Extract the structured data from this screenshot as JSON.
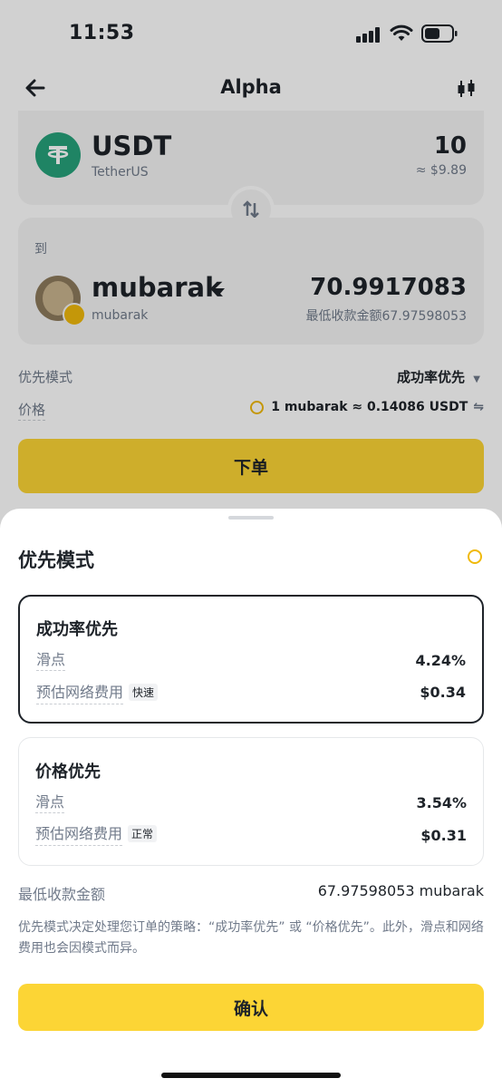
{
  "status_bar": {
    "time": "11:53"
  },
  "header": {
    "title": "Alpha"
  },
  "from": {
    "symbol": "USDT",
    "name": "TetherUS",
    "amount": "10",
    "usd_value": "≈ $9.89"
  },
  "to": {
    "label": "到",
    "symbol": "mubarak",
    "name": "mubarak",
    "amount": "70.9917083",
    "min_receive": "最低收款金额67.97598053"
  },
  "settings": {
    "priority_label": "优先模式",
    "priority_value": "成功率优先",
    "price_label": "价格",
    "price_value": "1 mubarak ≈ 0.14086 USDT"
  },
  "order_button": "下单",
  "sheet": {
    "title": "优先模式",
    "options": [
      {
        "title": "成功率优先",
        "slippage_label": "滑点",
        "slippage_value": "4.24%",
        "fee_label": "预估网络费用",
        "fee_tag": "快速",
        "fee_value": "$0.34",
        "selected": true
      },
      {
        "title": "价格优先",
        "slippage_label": "滑点",
        "slippage_value": "3.54%",
        "fee_label": "预估网络费用",
        "fee_tag": "正常",
        "fee_value": "$0.31",
        "selected": false
      }
    ],
    "min_receive_label": "最低收款金额",
    "min_receive_value": "67.97598053 mubarak",
    "description": "优先模式决定处理您订单的策略：“成功率优先” 或 “价格优先”。此外，滑点和网络费用也会因模式而异。",
    "confirm_button": "确认"
  },
  "colors": {
    "accent": "#fcd535",
    "tether": "#26a17b",
    "text": "#1e2329",
    "muted": "#707a8a"
  }
}
